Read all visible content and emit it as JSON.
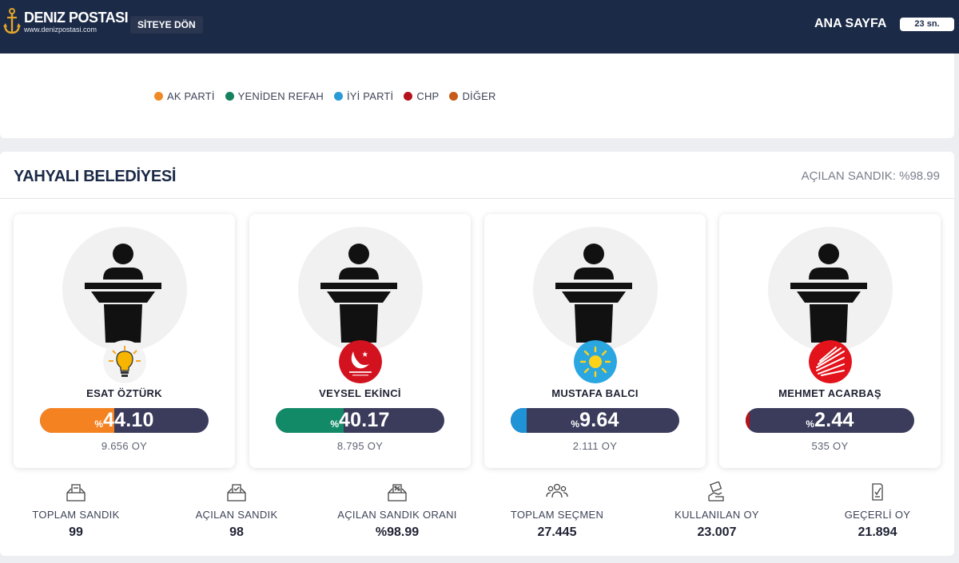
{
  "header": {
    "logo_title": "DENIZ POSTASI",
    "logo_url": "www.denizpostasi.com",
    "back_label": "SİTEYE DÖN",
    "home_label": "ANA SAYFA",
    "timer": "23 sn."
  },
  "legend": [
    {
      "label": "AK PARTİ",
      "color": "#f08a24"
    },
    {
      "label": "YENİDEN REFAH",
      "color": "#16815f"
    },
    {
      "label": "İYİ PARTİ",
      "color": "#2a9bd7"
    },
    {
      "label": "CHP",
      "color": "#b5121b"
    },
    {
      "label": "DİĞER",
      "color": "#c55a1a"
    }
  ],
  "result": {
    "title": "YAHYALI BELEDİYESİ",
    "opened_boxes_text": "AÇILAN SANDIK: %98.99"
  },
  "candidates": [
    {
      "name": "ESAT ÖZTÜRK",
      "percent_sign": "%",
      "percent": "44.10",
      "fill": 0.441,
      "votes": "9.656 OY",
      "color": "#f58220",
      "party_icon": "ak-parti-bulb-icon"
    },
    {
      "name": "VEYSEL EKİNCİ",
      "percent_sign": "%",
      "percent": "40.17",
      "fill": 0.4017,
      "votes": "8.795 OY",
      "color": "#138a67",
      "party_icon": "yeniden-refah-icon"
    },
    {
      "name": "MUSTAFA BALCI",
      "percent_sign": "%",
      "percent": "9.64",
      "fill": 0.0964,
      "votes": "2.111 OY",
      "color": "#1f93d6",
      "party_icon": "iyi-parti-sun-icon"
    },
    {
      "name": "MEHMET ACARBAŞ",
      "percent_sign": "%",
      "percent": "2.44",
      "fill": 0.0244,
      "votes": "535 OY",
      "color": "#b5121b",
      "party_icon": "chp-arrows-icon"
    }
  ],
  "stats": [
    {
      "label": "TOPLAM SANDIK",
      "value": "99",
      "icon": "ballot-box-icon"
    },
    {
      "label": "AÇILAN SANDIK",
      "value": "98",
      "icon": "ballot-box-check-icon"
    },
    {
      "label": "AÇILAN SANDIK ORANI",
      "value": "%98.99",
      "icon": "ballot-box-percent-icon"
    },
    {
      "label": "TOPLAM SEÇMEN",
      "value": "27.445",
      "icon": "voters-group-icon"
    },
    {
      "label": "KULLANILAN OY",
      "value": "23.007",
      "icon": "hand-vote-icon"
    },
    {
      "label": "GEÇERLİ OY",
      "value": "21.894",
      "icon": "valid-ballot-icon"
    }
  ]
}
